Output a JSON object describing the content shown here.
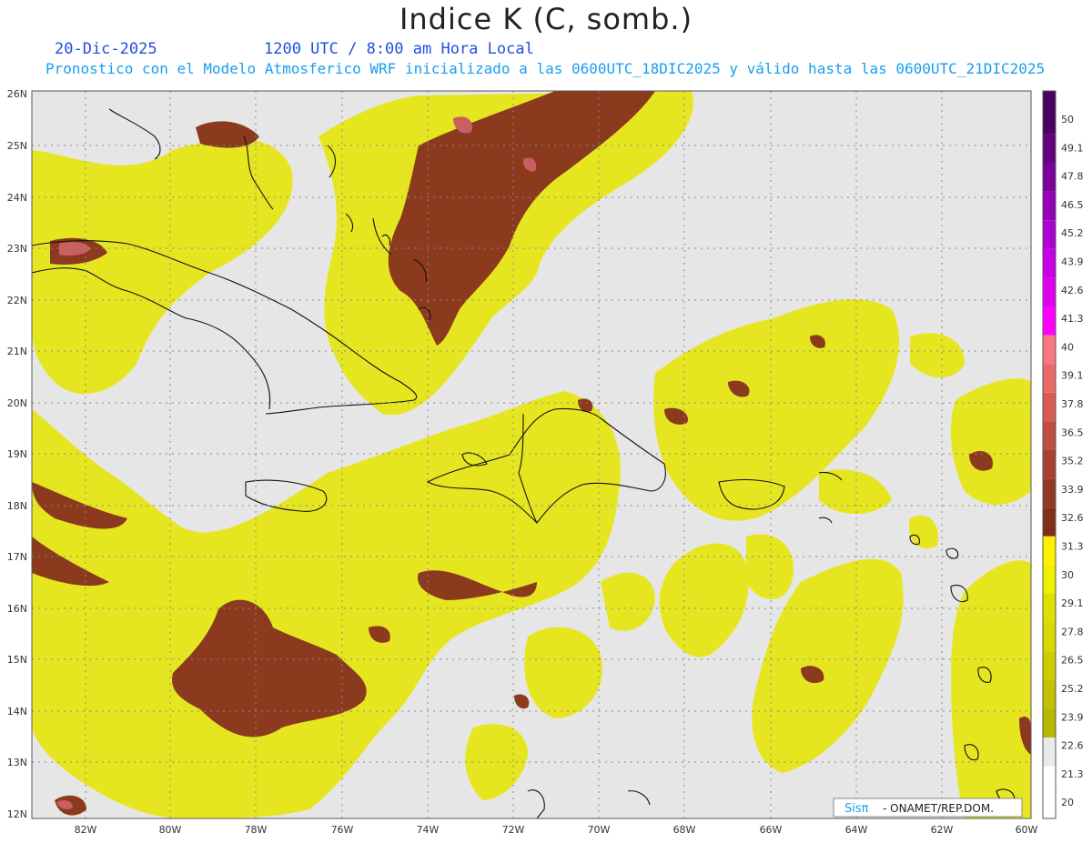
{
  "header": {
    "title": "Indice K (C, somb.)",
    "date": "20-Dic-2025",
    "time": "1200 UTC / 8:00 am Hora Local",
    "subtitle": "Pronostico con el Modelo Atmosferico WRF inicializado a las 0600UTC_18DIC2025 y válido hasta las  0600UTC_21DIC2025"
  },
  "axes": {
    "lat_labels": [
      "26N",
      "25N",
      "24N",
      "23N",
      "22N",
      "21N",
      "20N",
      "19N",
      "18N",
      "17N",
      "16N",
      "15N",
      "14N",
      "13N",
      "12N"
    ],
    "lon_labels": [
      "82W",
      "80W",
      "78W",
      "76W",
      "74W",
      "72W",
      "70W",
      "68W",
      "66W",
      "64W",
      "62W",
      "60W"
    ]
  },
  "colorbar": {
    "levels": [
      "50",
      "49.1",
      "47.8",
      "46.5",
      "45.2",
      "43.9",
      "42.6",
      "41.3",
      "40",
      "39.1",
      "37.8",
      "36.5",
      "35.2",
      "33.9",
      "32.6",
      "31.3",
      "30",
      "29.1",
      "27.8",
      "26.5",
      "25.2",
      "23.9",
      "22.6",
      "21.3",
      "20"
    ],
    "colors": [
      "#4b0060",
      "#62007e",
      "#7a009c",
      "#9300b8",
      "#ad00d2",
      "#c800e6",
      "#e000f0",
      "#ff00ff",
      "#f87880",
      "#e86a66",
      "#d85c52",
      "#c04e44",
      "#a84034",
      "#923826",
      "#80301a",
      "#fff200",
      "#eef000",
      "#e0e000",
      "#d6d800",
      "#cccc00",
      "#c2c200",
      "#b8b800",
      "#eaeaea"
    ]
  },
  "credit": {
    "brand": "Sisπ",
    "text": " - ONAMET/REP.DOM."
  },
  "colors": {
    "background": "#e6e6e6",
    "k_20_30": "#e8e81e",
    "k_30_plus": "#8b3a1e",
    "k_35_plus": "#c86060",
    "coastline": "#111111"
  }
}
